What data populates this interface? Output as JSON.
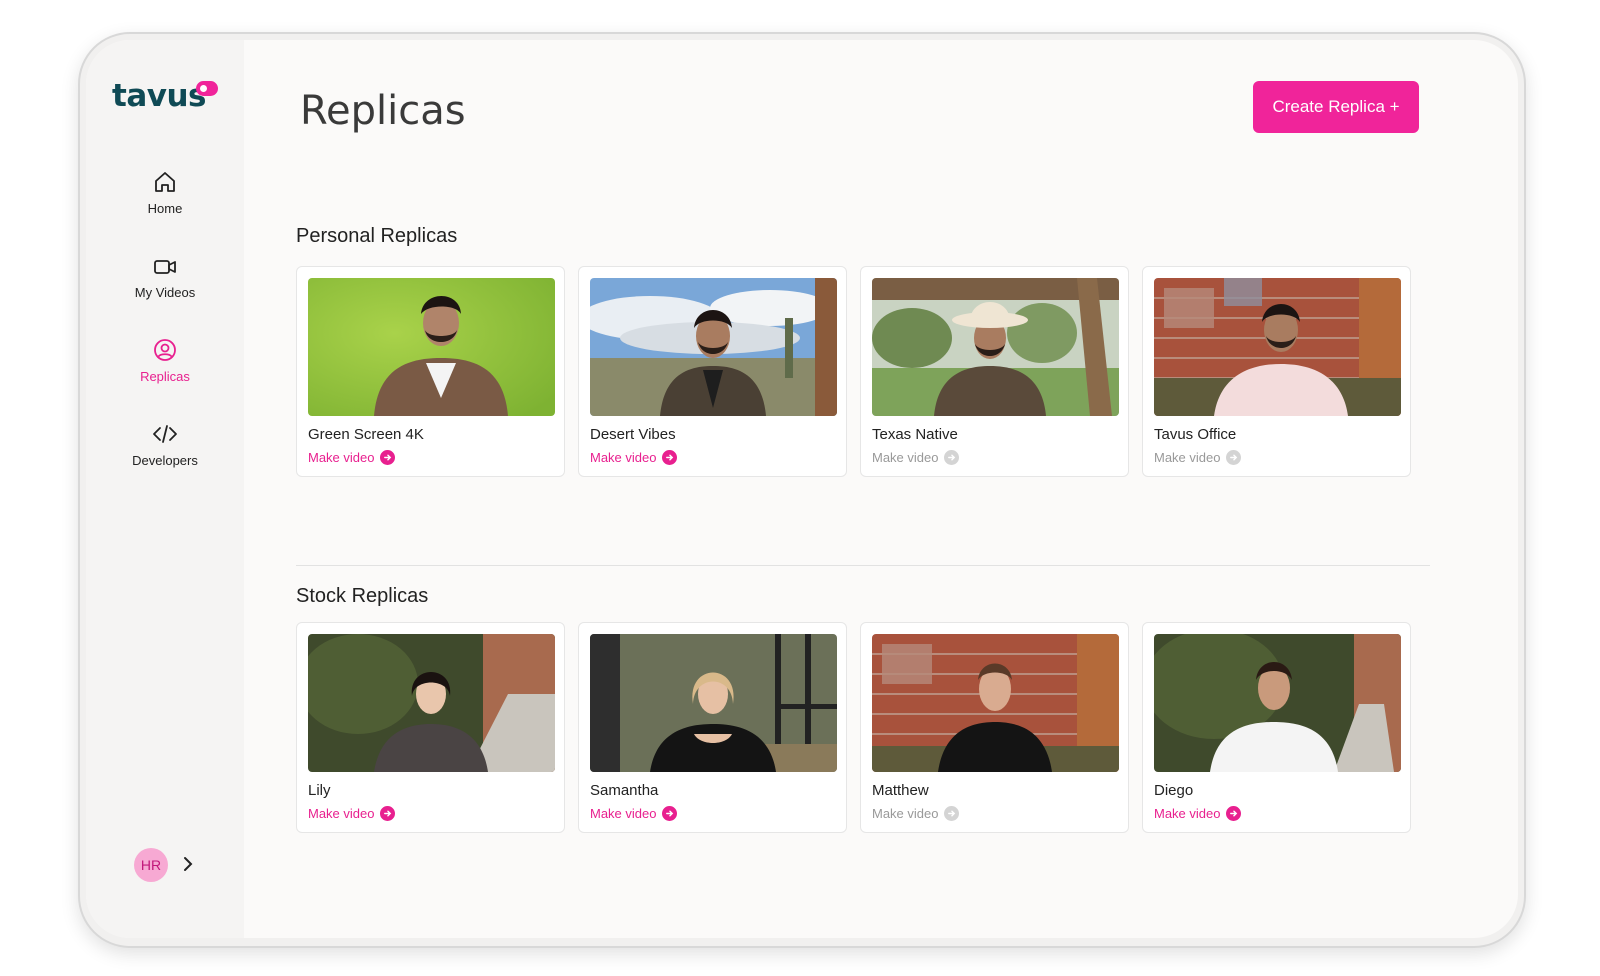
{
  "app": {
    "logo_text": "tavus",
    "page_title": "Replicas",
    "create_button": "Create Replica +"
  },
  "sidebar": {
    "items": [
      {
        "label": "Home",
        "icon": "home-icon",
        "active": false
      },
      {
        "label": "My Videos",
        "icon": "video-camera-icon",
        "active": false
      },
      {
        "label": "Replicas",
        "icon": "user-circle-icon",
        "active": true
      },
      {
        "label": "Developers",
        "icon": "code-icon",
        "active": false
      }
    ],
    "user_initials": "HR"
  },
  "sections": {
    "personal": {
      "title": "Personal Replicas",
      "cards": [
        {
          "name": "Green Screen 4K",
          "action": "Make video",
          "enabled": true
        },
        {
          "name": "Desert Vibes",
          "action": "Make video",
          "enabled": true
        },
        {
          "name": "Texas Native",
          "action": "Make video",
          "enabled": false
        },
        {
          "name": "Tavus Office",
          "action": "Make video",
          "enabled": false
        }
      ]
    },
    "stock": {
      "title": "Stock Replicas",
      "cards": [
        {
          "name": "Lily",
          "action": "Make video",
          "enabled": true
        },
        {
          "name": "Samantha",
          "action": "Make video",
          "enabled": true
        },
        {
          "name": "Matthew",
          "action": "Make video",
          "enabled": false
        },
        {
          "name": "Diego",
          "action": "Make video",
          "enabled": true
        }
      ]
    }
  },
  "colors": {
    "accent": "#f0249a",
    "logo": "#0f4a55",
    "disabled": "#999999"
  }
}
